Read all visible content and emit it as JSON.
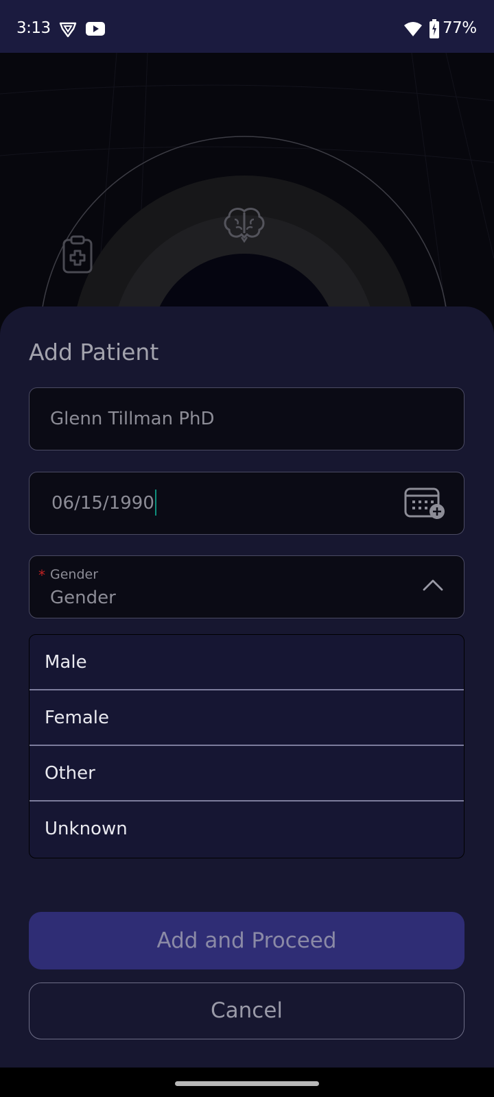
{
  "status_bar": {
    "time": "3:13",
    "battery": "77%",
    "icons": [
      "vpn-shield-icon",
      "youtube-icon",
      "wifi-icon",
      "battery-charging-icon"
    ]
  },
  "background_icons": [
    "clipboard-medical-icon",
    "brain-icon"
  ],
  "form": {
    "title": "Add Patient",
    "name_value": "Glenn Tillman PhD",
    "dob_value": "06/15/1990",
    "gender_label": "Gender",
    "gender_value": "Gender",
    "gender_options": [
      "Male",
      "Female",
      "Other",
      "Unknown"
    ],
    "primary_button_label": "Add and Proceed",
    "secondary_button_label": "Cancel"
  },
  "colors": {
    "status_bar_bg": "#1b1b3f",
    "sheet_bg": "#171730",
    "primary_button_bg": "#2f2d75",
    "caret": "#0f8f7d",
    "required_star": "#c22222"
  }
}
